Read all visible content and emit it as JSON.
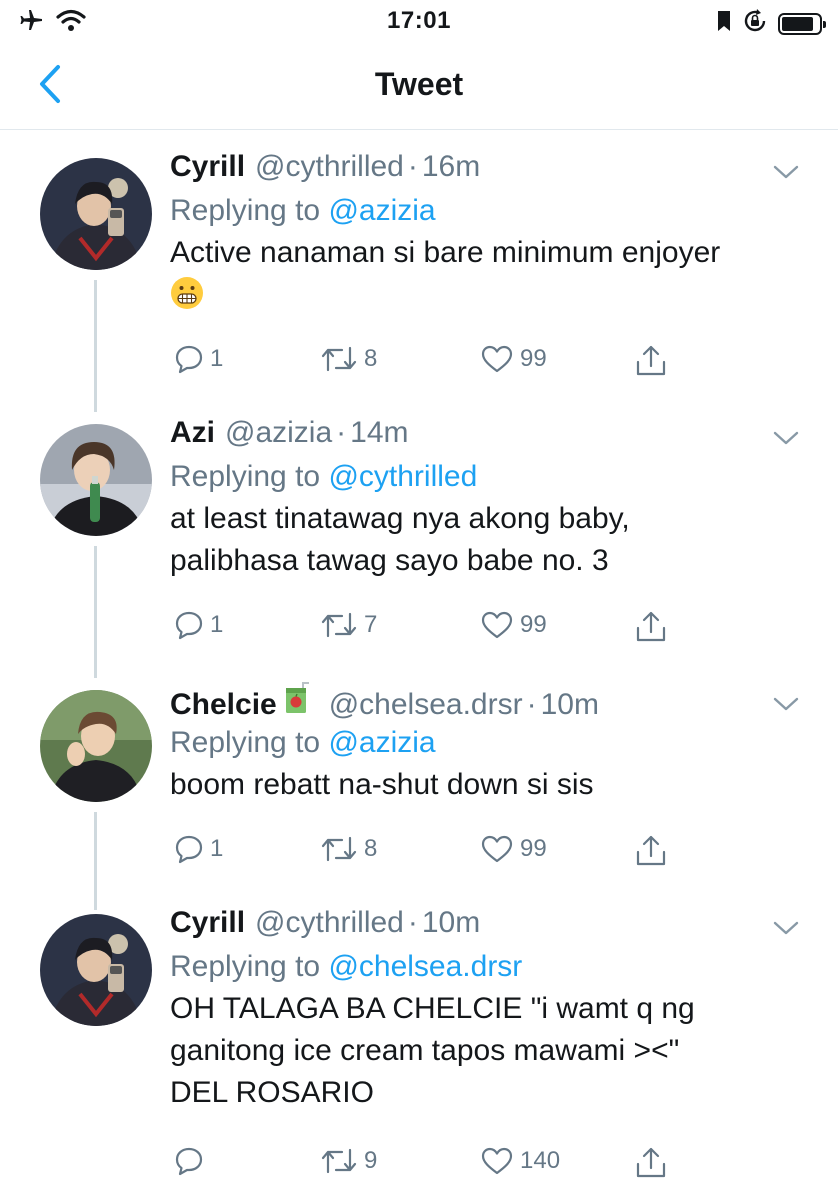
{
  "status_bar": {
    "time": "17:01"
  },
  "header": {
    "title": "Tweet"
  },
  "reply_prefix": "Replying to",
  "tweets": [
    {
      "name": "Cyrill",
      "handle": "@cythrilled",
      "separator": "·",
      "time": "16m",
      "reply_to": "@azizia",
      "text": "Active nanaman si bare minimum enjoyer",
      "emoji": "grimacing-face",
      "replies": "1",
      "retweets": "8",
      "likes": "99"
    },
    {
      "name": "Azi",
      "handle": "@azizia",
      "separator": "·",
      "time": "14m",
      "reply_to": "@cythrilled",
      "text_line1": "at least tinatawag nya akong baby,",
      "text_line2": "palibhasa tawag sayo babe no. 3",
      "replies": "1",
      "retweets": "7",
      "likes": "99"
    },
    {
      "name": "Chelcie",
      "name_emoji": "juice-box",
      "handle": "@chelsea.drsr",
      "separator": "·",
      "time": "10m",
      "reply_to": "@azizia",
      "text": "boom rebatt na-shut down si sis",
      "replies": "1",
      "retweets": "8",
      "likes": "99"
    },
    {
      "name": "Cyrill",
      "handle": "@cythrilled",
      "separator": "·",
      "time": "10m",
      "reply_to": "@chelsea.drsr",
      "text_line1": "OH TALAGA BA CHELCIE \"i wamt q ng",
      "text_line2": "ganitong ice cream tapos mawami ><\"",
      "text_line3": "DEL ROSARIO",
      "replies": "",
      "retweets": "9",
      "likes": "140"
    }
  ],
  "colors": {
    "accent": "#1da1f2",
    "text": "#14171a",
    "secondary": "#657786",
    "thread_line": "#cfd9de",
    "divider": "#e1e8ed"
  },
  "icons": [
    "airplane-icon",
    "wifi-icon",
    "bookmark-icon",
    "rotation-lock-icon",
    "battery-icon",
    "back-chevron-icon",
    "reply-icon",
    "retweet-icon",
    "like-icon",
    "share-icon",
    "tweet-menu-chevron-icon"
  ],
  "battery_level": 0.85
}
